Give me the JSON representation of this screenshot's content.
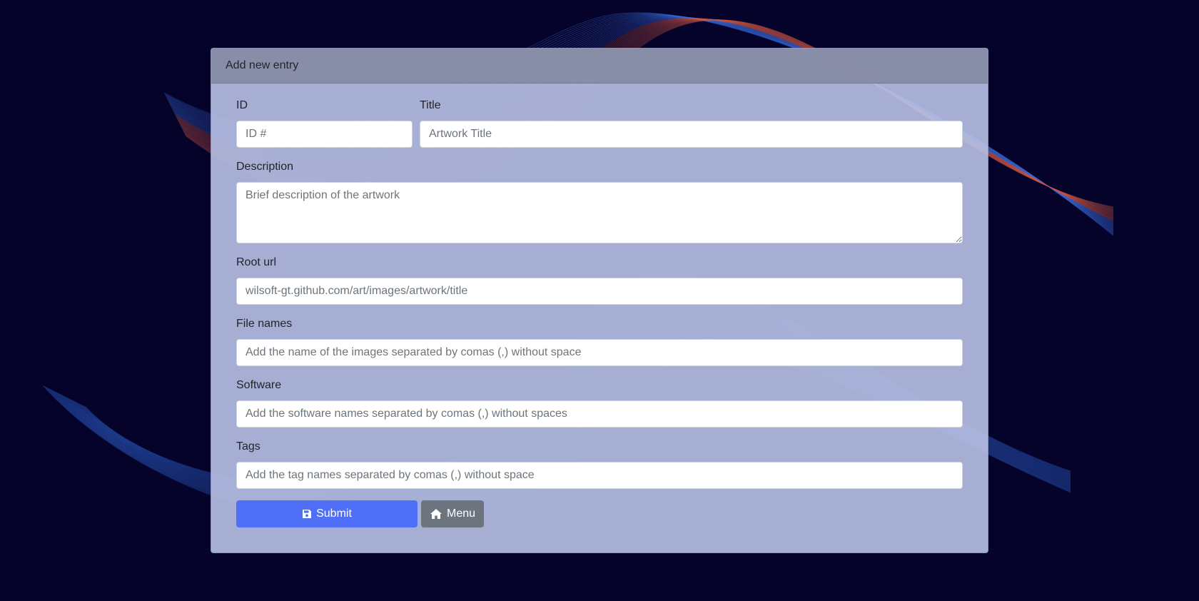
{
  "card": {
    "title": "Add new entry"
  },
  "form": {
    "id": {
      "label": "ID",
      "placeholder": "ID #",
      "value": ""
    },
    "title": {
      "label": "Title",
      "placeholder": "Artwork Title",
      "value": ""
    },
    "description": {
      "label": "Description",
      "placeholder": "Brief description of the artwork",
      "value": ""
    },
    "root_url": {
      "label": "Root url",
      "placeholder": "wilsoft-gt.github.com/art/images/artwork/title",
      "value": ""
    },
    "file_names": {
      "label": "File names",
      "placeholder": "Add the name of the images separated by comas (,) without space",
      "value": ""
    },
    "software": {
      "label": "Software",
      "placeholder": "Add the software names separated by comas (,) without spaces",
      "value": ""
    },
    "tags": {
      "label": "Tags",
      "placeholder": "Add the tag names separated by comas (,) without space",
      "value": ""
    }
  },
  "buttons": {
    "submit": {
      "label": "Submit",
      "icon": "save-icon",
      "color": "#4f6ff7"
    },
    "menu": {
      "label": "Menu",
      "icon": "home-icon",
      "color": "#6c757d"
    }
  },
  "colors": {
    "background": "#05032a",
    "card": "#b8c1e6"
  }
}
